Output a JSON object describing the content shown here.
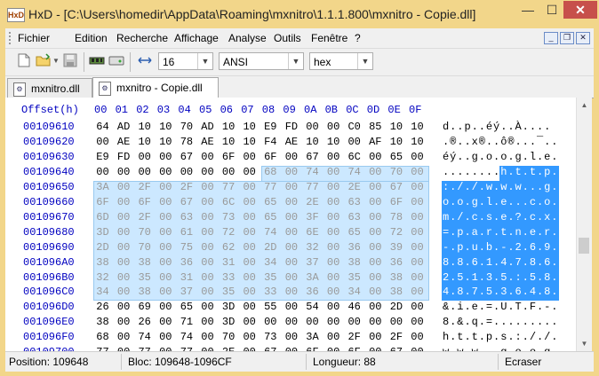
{
  "window": {
    "title": "HxD - [C:\\Users\\homedir\\AppData\\Roaming\\mxnitro\\1.1.1.800\\mxnitro - Copie.dll]",
    "app_icon_text": "HxD",
    "min": "—",
    "max": "☐",
    "close": "✕"
  },
  "menu": {
    "items": [
      "Fichier",
      "Edition",
      "Recherche",
      "Affichage",
      "Analyse",
      "Outils",
      "Fenêtre",
      "?"
    ],
    "mdi_min": "_",
    "mdi_restore": "❐",
    "mdi_close": "✕"
  },
  "toolbar": {
    "bytes_per_row": "16",
    "charset": "ANSI",
    "offset_base": "hex",
    "icons": [
      "new-file-icon",
      "open-file-icon",
      "save-icon",
      "ram-icon",
      "disk-icon",
      "columns-icon"
    ]
  },
  "tabs": [
    {
      "label": "mxnitro.dll",
      "active": false
    },
    {
      "label": "mxnitro - Copie.dll",
      "active": true
    }
  ],
  "editor": {
    "offset_header": "Offset(h)",
    "col_headers": [
      "00",
      "01",
      "02",
      "03",
      "04",
      "05",
      "06",
      "07",
      "08",
      "09",
      "0A",
      "0B",
      "0C",
      "0D",
      "0E",
      "0F"
    ],
    "rows": [
      {
        "offset": "00109610",
        "bytes": [
          "64",
          "AD",
          "10",
          "10",
          "70",
          "AD",
          "10",
          "10",
          "E9",
          "FD",
          "00",
          "00",
          "C0",
          "85",
          "10",
          "10"
        ],
        "text": "d..p..éý..À...."
      },
      {
        "offset": "00109620",
        "bytes": [
          "00",
          "AE",
          "10",
          "10",
          "78",
          "AE",
          "10",
          "10",
          "F4",
          "AE",
          "10",
          "10",
          "00",
          "AF",
          "10",
          "10"
        ],
        "text": ".®..x®..ô®...¯.."
      },
      {
        "offset": "00109630",
        "bytes": [
          "E9",
          "FD",
          "00",
          "00",
          "67",
          "00",
          "6F",
          "00",
          "6F",
          "00",
          "67",
          "00",
          "6C",
          "00",
          "65",
          "00"
        ],
        "text": "éý..g.o.o.g.l.e."
      },
      {
        "offset": "00109640",
        "bytes": [
          "00",
          "00",
          "00",
          "00",
          "00",
          "00",
          "00",
          "00",
          "68",
          "00",
          "74",
          "00",
          "74",
          "00",
          "70",
          "00"
        ],
        "text": "........h.t.t.p."
      },
      {
        "offset": "00109650",
        "bytes": [
          "3A",
          "00",
          "2F",
          "00",
          "2F",
          "00",
          "77",
          "00",
          "77",
          "00",
          "77",
          "00",
          "2E",
          "00",
          "67",
          "00"
        ],
        "text": ":././.w.w.w...g."
      },
      {
        "offset": "00109660",
        "bytes": [
          "6F",
          "00",
          "6F",
          "00",
          "67",
          "00",
          "6C",
          "00",
          "65",
          "00",
          "2E",
          "00",
          "63",
          "00",
          "6F",
          "00"
        ],
        "text": "o.o.g.l.e...c.o."
      },
      {
        "offset": "00109670",
        "bytes": [
          "6D",
          "00",
          "2F",
          "00",
          "63",
          "00",
          "73",
          "00",
          "65",
          "00",
          "3F",
          "00",
          "63",
          "00",
          "78",
          "00"
        ],
        "text": "m./.c.s.e.?.c.x."
      },
      {
        "offset": "00109680",
        "bytes": [
          "3D",
          "00",
          "70",
          "00",
          "61",
          "00",
          "72",
          "00",
          "74",
          "00",
          "6E",
          "00",
          "65",
          "00",
          "72",
          "00"
        ],
        "text": "=.p.a.r.t.n.e.r."
      },
      {
        "offset": "00109690",
        "bytes": [
          "2D",
          "00",
          "70",
          "00",
          "75",
          "00",
          "62",
          "00",
          "2D",
          "00",
          "32",
          "00",
          "36",
          "00",
          "39",
          "00"
        ],
        "text": "-.p.u.b.-.2.6.9."
      },
      {
        "offset": "001096A0",
        "bytes": [
          "38",
          "00",
          "38",
          "00",
          "36",
          "00",
          "31",
          "00",
          "34",
          "00",
          "37",
          "00",
          "38",
          "00",
          "36",
          "00"
        ],
        "text": "8.8.6.1.4.7.8.6."
      },
      {
        "offset": "001096B0",
        "bytes": [
          "32",
          "00",
          "35",
          "00",
          "31",
          "00",
          "33",
          "00",
          "35",
          "00",
          "3A",
          "00",
          "35",
          "00",
          "38",
          "00"
        ],
        "text": "2.5.1.3.5.:.5.8."
      },
      {
        "offset": "001096C0",
        "bytes": [
          "34",
          "00",
          "38",
          "00",
          "37",
          "00",
          "35",
          "00",
          "33",
          "00",
          "36",
          "00",
          "34",
          "00",
          "38",
          "00"
        ],
        "text": "4.8.7.5.3.6.4.8."
      },
      {
        "offset": "001096D0",
        "bytes": [
          "26",
          "00",
          "69",
          "00",
          "65",
          "00",
          "3D",
          "00",
          "55",
          "00",
          "54",
          "00",
          "46",
          "00",
          "2D",
          "00"
        ],
        "text": "&.i.e.=.U.T.F.-."
      },
      {
        "offset": "001096E0",
        "bytes": [
          "38",
          "00",
          "26",
          "00",
          "71",
          "00",
          "3D",
          "00",
          "00",
          "00",
          "00",
          "00",
          "00",
          "00",
          "00",
          "00"
        ],
        "text": "8.&.q.=........."
      },
      {
        "offset": "001096F0",
        "bytes": [
          "68",
          "00",
          "74",
          "00",
          "74",
          "00",
          "70",
          "00",
          "73",
          "00",
          "3A",
          "00",
          "2F",
          "00",
          "2F",
          "00"
        ],
        "text": "h.t.t.p.s.:././."
      },
      {
        "offset": "00109700",
        "bytes": [
          "77",
          "00",
          "77",
          "00",
          "77",
          "00",
          "2E",
          "00",
          "67",
          "00",
          "6F",
          "00",
          "6F",
          "00",
          "67",
          "00"
        ],
        "text": "w.w.w...g.o.o.g."
      }
    ]
  },
  "status": {
    "position": "Position: 109648",
    "block": "Bloc: 109648-1096CF",
    "length": "Longueur: 88",
    "mode": "Ecraser"
  },
  "colors": {
    "titlebar": "#f2d68a",
    "offset_text": "#0000c0",
    "selection_hex_bg": "#cce8ff",
    "selection_text_bg": "#3399ff"
  }
}
